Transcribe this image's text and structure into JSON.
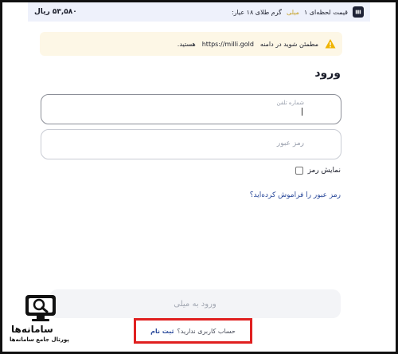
{
  "topbar": {
    "price_text_prefix": "قیمت لحظه‌ای ۱",
    "price_text_highlight": "میلی",
    "price_text_suffix": "گرم طلای ۱۸ عیار:",
    "price_value": "۵۳,۵۸۰ ریال"
  },
  "warning": {
    "text_prefix": "مطمئن شوید در دامنه",
    "domain": "https://milli.gold",
    "text_suffix": "هستید."
  },
  "login": {
    "title": "ورود",
    "phone_label": "شماره تلفن",
    "password_placeholder": "رمز عبور",
    "show_password_label": "نمایش رمز",
    "forgot_link": "رمز عبور را فراموش کرده‌اید؟",
    "submit_label": "ورود به میلی",
    "no_account_text": "حساب کاربری ندارید؟",
    "signup_link": "ثبت نام"
  },
  "watermark": {
    "name": "سامانه‌ها",
    "tagline": "پورتال جامع سامانه‌ها"
  },
  "colors": {
    "accent": "#2b4a9b",
    "highlight_frame": "#e02020",
    "warning_bg": "#fdf7e6"
  }
}
